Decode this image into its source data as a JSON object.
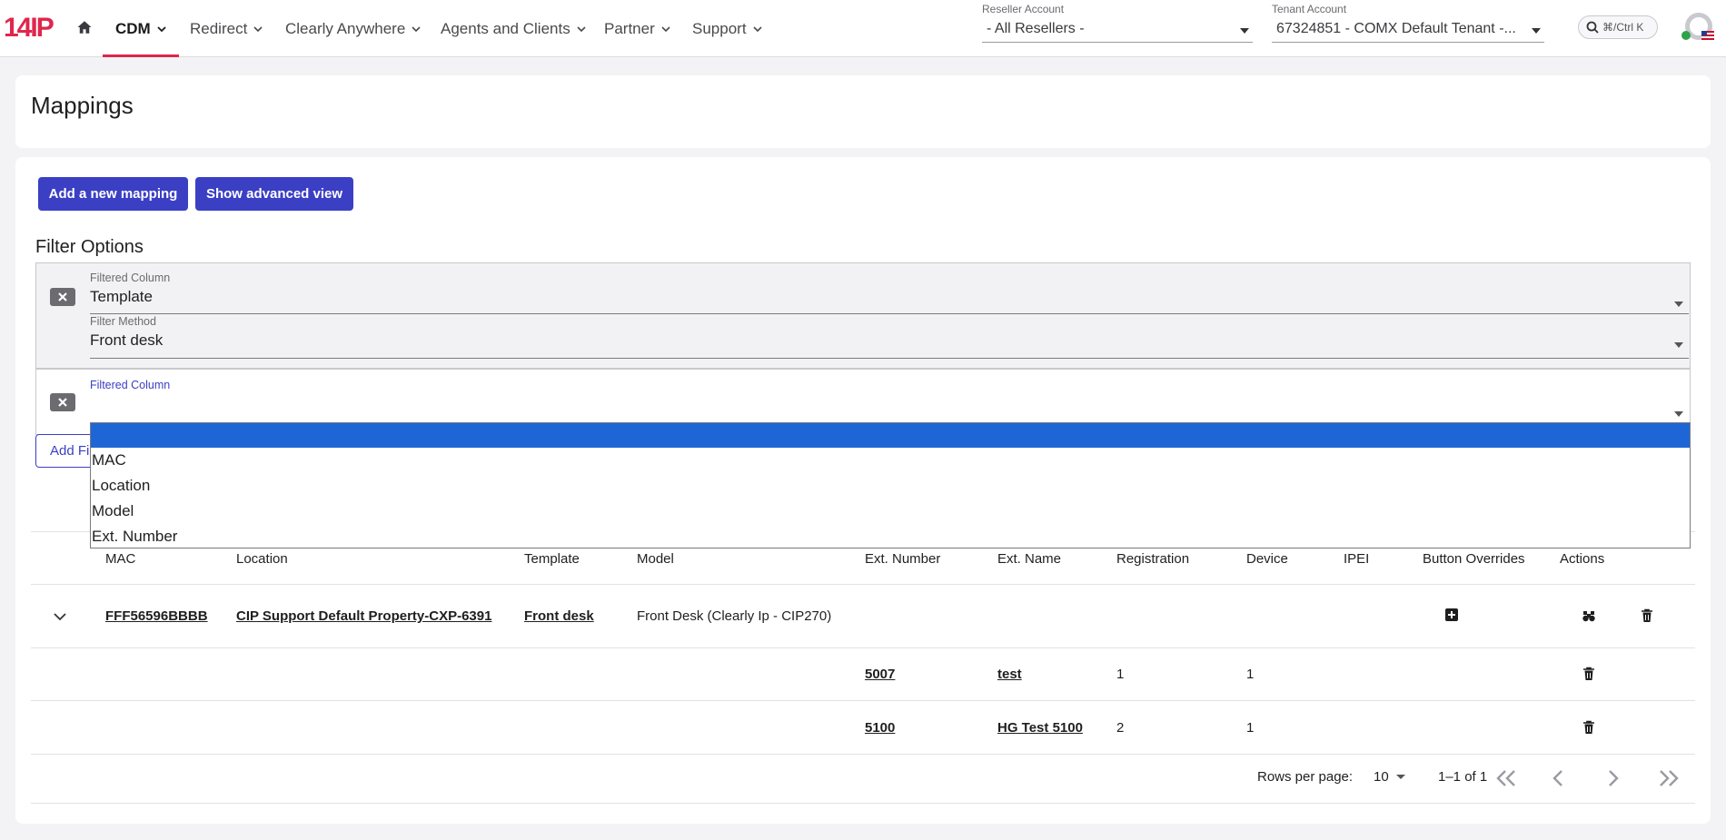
{
  "brand": {
    "logo": "14IP",
    "accent": "#e0264c",
    "primary": "#3b3fc4"
  },
  "nav": {
    "items": [
      {
        "label": "CDM"
      },
      {
        "label": "Redirect"
      },
      {
        "label": "Clearly Anywhere"
      },
      {
        "label": "Agents and Clients"
      },
      {
        "label": "Partner"
      },
      {
        "label": "Support"
      }
    ]
  },
  "accounts": {
    "reseller": {
      "label": "Reseller Account",
      "value": "-  All Resellers -"
    },
    "tenant": {
      "label": "Tenant Account",
      "value": "67324851 - COMX Default Tenant -..."
    }
  },
  "search": {
    "shortcut": "⌘/Ctrl K"
  },
  "page": {
    "title": "Mappings"
  },
  "buttons": {
    "add_mapping": "Add a new mapping",
    "advanced_view": "Show advanced view",
    "add_filter": "Add Fi"
  },
  "filters": {
    "title": "Filter Options",
    "rows": [
      {
        "column_label": "Filtered Column",
        "column_value": "Template",
        "method_label": "Filter Method",
        "method_value": "Front desk"
      },
      {
        "column_label": "Filtered Column",
        "column_value": ""
      }
    ],
    "dropdown_options": [
      "",
      "MAC",
      "Location",
      "Model",
      "Ext. Number"
    ]
  },
  "table": {
    "headers": [
      "MAC",
      "Location",
      "Template",
      "Model",
      "Ext. Number",
      "Ext. Name",
      "Registration",
      "Device",
      "IPEI",
      "Button Overrides",
      "Actions"
    ],
    "row": {
      "mac": "FFF56596BBBB",
      "location": "CIP Support Default Property-CXP-6391",
      "template": "Front desk",
      "model": "Front Desk (Clearly Ip - CIP270)"
    },
    "sub_rows": [
      {
        "ext_number": "5007",
        "ext_name": "test",
        "registration": "1",
        "device": "1"
      },
      {
        "ext_number": "5100",
        "ext_name": "HG Test 5100",
        "registration": "2",
        "device": "1"
      }
    ]
  },
  "pagination": {
    "rows_per_page_label": "Rows per page:",
    "rows_per_page": "10",
    "range": "1–1 of 1"
  }
}
